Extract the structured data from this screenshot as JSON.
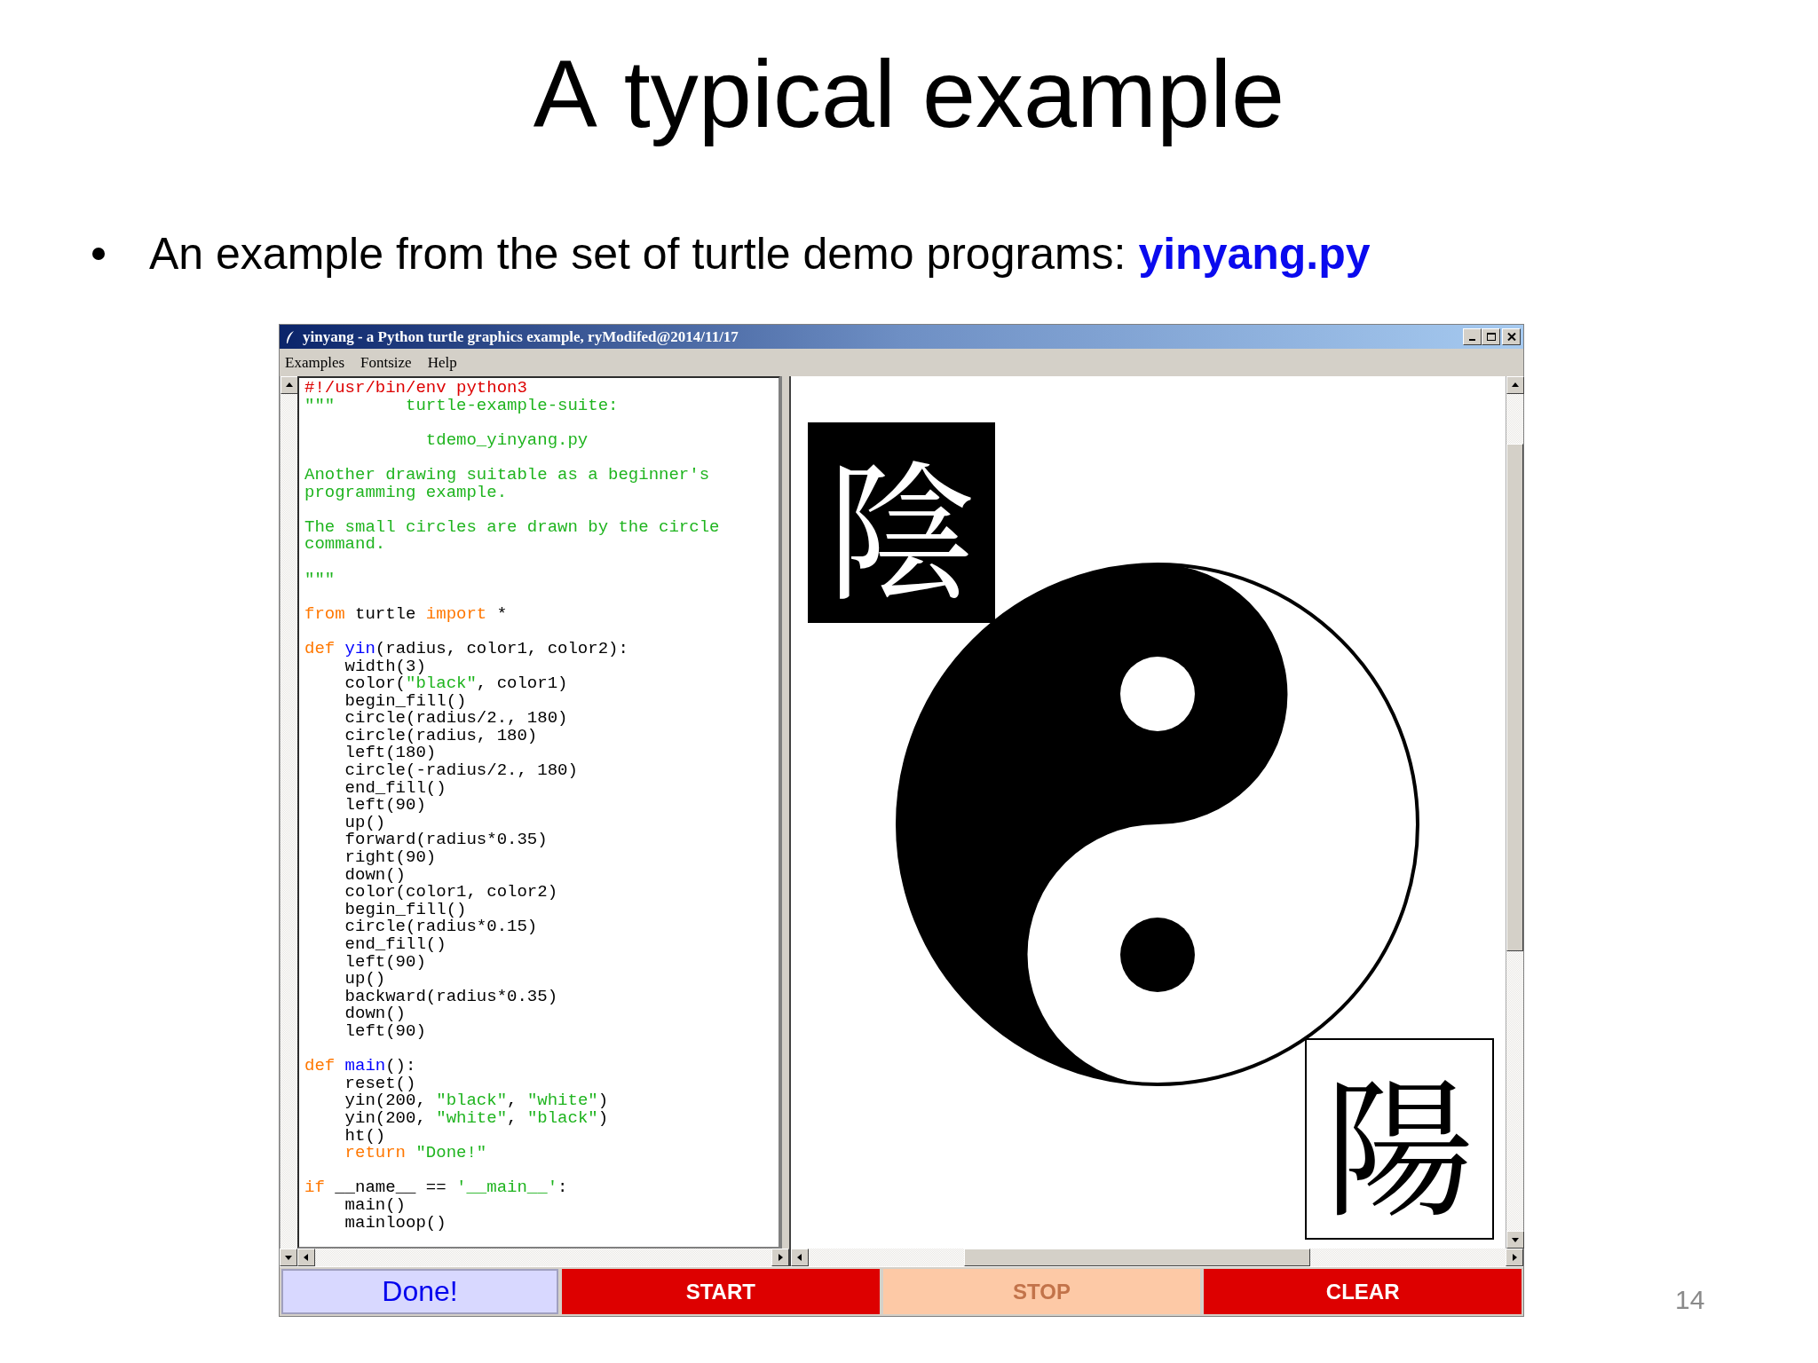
{
  "slide": {
    "title": "A typical example",
    "bullet": "An example from the set of turtle demo programs: **yinyang.py**",
    "page_number": "14"
  },
  "window": {
    "title": "yinyang - a Python turtle graphics example, ryModifed@2014/11/17",
    "menu": [
      "Examples",
      "Fontsize",
      "Help"
    ],
    "code": [
      {
        "kind": "code",
        "tokens": [
          {
            "t": "#!/usr/bin/env python3",
            "kind": "shebang"
          }
        ]
      },
      {
        "kind": "code",
        "tokens": [
          {
            "t": "\"\"\"       turtle-example-suite:",
            "kind": "string"
          }
        ]
      },
      {
        "kind": "blank"
      },
      {
        "kind": "code",
        "tokens": [
          {
            "t": "            tdemo_yinyang.py",
            "kind": "string"
          }
        ]
      },
      {
        "kind": "blank"
      },
      {
        "kind": "code",
        "tokens": [
          {
            "t": "Another drawing suitable as a beginner's",
            "kind": "string"
          }
        ]
      },
      {
        "kind": "code",
        "tokens": [
          {
            "t": "programming example.",
            "kind": "string"
          }
        ]
      },
      {
        "kind": "blank"
      },
      {
        "kind": "code",
        "tokens": [
          {
            "t": "The small circles are drawn by the circle",
            "kind": "string"
          }
        ]
      },
      {
        "kind": "code",
        "tokens": [
          {
            "t": "command.",
            "kind": "string"
          }
        ]
      },
      {
        "kind": "blank"
      },
      {
        "kind": "code",
        "tokens": [
          {
            "t": "\"\"\"",
            "kind": "string"
          }
        ]
      },
      {
        "kind": "blank"
      },
      {
        "kind": "code",
        "tokens": [
          {
            "t": "from",
            "kind": "keyword"
          },
          {
            "t": " turtle ",
            "kind": "plain"
          },
          {
            "t": "import",
            "kind": "keyword"
          },
          {
            "t": " *",
            "kind": "plain"
          }
        ]
      },
      {
        "kind": "blank"
      },
      {
        "kind": "code",
        "tokens": [
          {
            "t": "def ",
            "kind": "keyword"
          },
          {
            "t": "yin",
            "kind": "name"
          },
          {
            "t": "(radius, color1, color2):",
            "kind": "plain"
          }
        ]
      },
      {
        "kind": "code",
        "tokens": [
          {
            "t": "    width(3)",
            "kind": "plain"
          }
        ]
      },
      {
        "kind": "code",
        "tokens": [
          {
            "t": "    color(",
            "kind": "plain"
          },
          {
            "t": "\"black\"",
            "kind": "string"
          },
          {
            "t": ", color1)",
            "kind": "plain"
          }
        ]
      },
      {
        "kind": "code",
        "tokens": [
          {
            "t": "    begin_fill()",
            "kind": "plain"
          }
        ]
      },
      {
        "kind": "code",
        "tokens": [
          {
            "t": "    circle(radius/2., 180)",
            "kind": "plain"
          }
        ]
      },
      {
        "kind": "code",
        "tokens": [
          {
            "t": "    circle(radius, 180)",
            "kind": "plain"
          }
        ]
      },
      {
        "kind": "code",
        "tokens": [
          {
            "t": "    left(180)",
            "kind": "plain"
          }
        ]
      },
      {
        "kind": "code",
        "tokens": [
          {
            "t": "    circle(-radius/2., 180)",
            "kind": "plain"
          }
        ]
      },
      {
        "kind": "code",
        "tokens": [
          {
            "t": "    end_fill()",
            "kind": "plain"
          }
        ]
      },
      {
        "kind": "code",
        "tokens": [
          {
            "t": "    left(90)",
            "kind": "plain"
          }
        ]
      },
      {
        "kind": "code",
        "tokens": [
          {
            "t": "    up()",
            "kind": "plain"
          }
        ]
      },
      {
        "kind": "code",
        "tokens": [
          {
            "t": "    forward(radius*0.35)",
            "kind": "plain"
          }
        ]
      },
      {
        "kind": "code",
        "tokens": [
          {
            "t": "    right(90)",
            "kind": "plain"
          }
        ]
      },
      {
        "kind": "code",
        "tokens": [
          {
            "t": "    down()",
            "kind": "plain"
          }
        ]
      },
      {
        "kind": "code",
        "tokens": [
          {
            "t": "    color(color1, color2)",
            "kind": "plain"
          }
        ]
      },
      {
        "kind": "code",
        "tokens": [
          {
            "t": "    begin_fill()",
            "kind": "plain"
          }
        ]
      },
      {
        "kind": "code",
        "tokens": [
          {
            "t": "    circle(radius*0.15)",
            "kind": "plain"
          }
        ]
      },
      {
        "kind": "code",
        "tokens": [
          {
            "t": "    end_fill()",
            "kind": "plain"
          }
        ]
      },
      {
        "kind": "code",
        "tokens": [
          {
            "t": "    left(90)",
            "kind": "plain"
          }
        ]
      },
      {
        "kind": "code",
        "tokens": [
          {
            "t": "    up()",
            "kind": "plain"
          }
        ]
      },
      {
        "kind": "code",
        "tokens": [
          {
            "t": "    backward(radius*0.35)",
            "kind": "plain"
          }
        ]
      },
      {
        "kind": "code",
        "tokens": [
          {
            "t": "    down()",
            "kind": "plain"
          }
        ]
      },
      {
        "kind": "code",
        "tokens": [
          {
            "t": "    left(90)",
            "kind": "plain"
          }
        ]
      },
      {
        "kind": "blank"
      },
      {
        "kind": "code",
        "tokens": [
          {
            "t": "def ",
            "kind": "keyword"
          },
          {
            "t": "main",
            "kind": "name"
          },
          {
            "t": "():",
            "kind": "plain"
          }
        ]
      },
      {
        "kind": "code",
        "tokens": [
          {
            "t": "    reset()",
            "kind": "plain"
          }
        ]
      },
      {
        "kind": "code",
        "tokens": [
          {
            "t": "    yin(200, ",
            "kind": "plain"
          },
          {
            "t": "\"black\"",
            "kind": "string"
          },
          {
            "t": ", ",
            "kind": "plain"
          },
          {
            "t": "\"white\"",
            "kind": "string"
          },
          {
            "t": ")",
            "kind": "plain"
          }
        ]
      },
      {
        "kind": "code",
        "tokens": [
          {
            "t": "    yin(200, ",
            "kind": "plain"
          },
          {
            "t": "\"white\"",
            "kind": "string"
          },
          {
            "t": ", ",
            "kind": "plain"
          },
          {
            "t": "\"black\"",
            "kind": "string"
          },
          {
            "t": ")",
            "kind": "plain"
          }
        ]
      },
      {
        "kind": "code",
        "tokens": [
          {
            "t": "    ht()",
            "kind": "plain"
          }
        ]
      },
      {
        "kind": "code",
        "tokens": [
          {
            "t": "    return ",
            "kind": "keyword"
          },
          {
            "t": "\"Done!\"",
            "kind": "string"
          }
        ]
      },
      {
        "kind": "blank"
      },
      {
        "kind": "code",
        "tokens": [
          {
            "t": "if",
            "kind": "keyword"
          },
          {
            "t": " __name__ == ",
            "kind": "plain"
          },
          {
            "t": "'__main__'",
            "kind": "string"
          },
          {
            "t": ":",
            "kind": "plain"
          }
        ]
      },
      {
        "kind": "code",
        "tokens": [
          {
            "t": "    main()",
            "kind": "plain"
          }
        ]
      },
      {
        "kind": "code",
        "tokens": [
          {
            "t": "    mainloop()",
            "kind": "plain"
          }
        ]
      }
    ],
    "canvas": {
      "labels": [
        {
          "text": "陰",
          "kind": "dark"
        },
        {
          "text": "陽",
          "kind": "light"
        }
      ]
    },
    "status": "Done!",
    "buttons": [
      {
        "label": "START",
        "disabled": false
      },
      {
        "label": "STOP",
        "disabled": true
      },
      {
        "label": "CLEAR",
        "disabled": false
      }
    ]
  }
}
